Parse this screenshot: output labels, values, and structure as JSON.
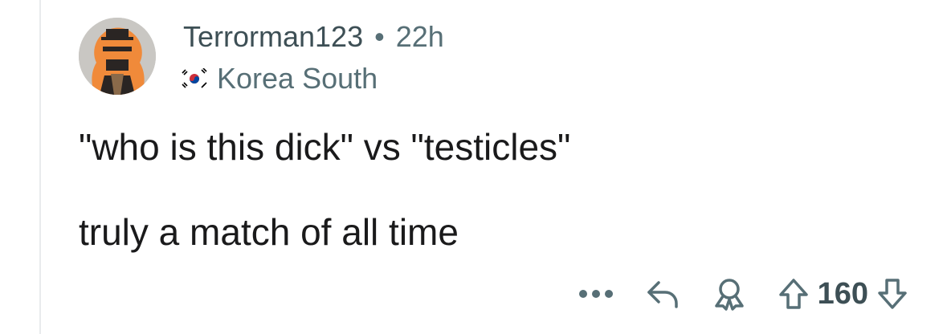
{
  "comment": {
    "author": "Terrorman123",
    "separator": "•",
    "age": "22h",
    "flair": {
      "text": "Korea South",
      "icon": "south-korea-flag-icon"
    },
    "body_lines": [
      "\"who is this dick\" vs \"testicles\"",
      "truly a match of all time"
    ],
    "score": "160"
  },
  "actions": {
    "more_icon": "more-options-icon",
    "reply_icon": "reply-icon",
    "award_icon": "award-icon",
    "upvote_icon": "upvote-arrow-icon",
    "downvote_icon": "downvote-arrow-icon"
  },
  "colors": {
    "text_primary": "#1a1a1b",
    "text_meta": "#576f76",
    "thread_line": "#e9ebed",
    "avatar_orange": "#f08a3a"
  }
}
